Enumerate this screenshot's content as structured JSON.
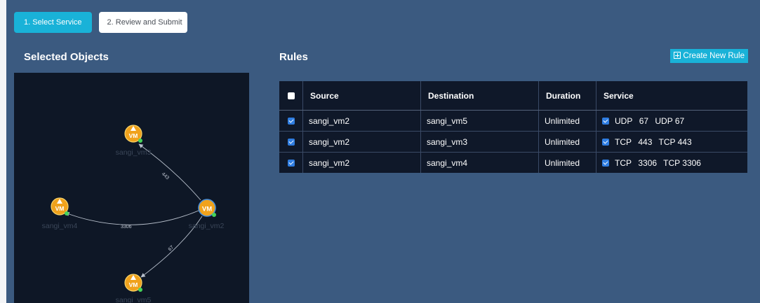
{
  "wizard": {
    "steps": [
      {
        "label": "1. Select Service",
        "active": true
      },
      {
        "label": "2. Review and Submit",
        "active": false
      }
    ]
  },
  "left_panel": {
    "title": "Selected Objects"
  },
  "graph": {
    "nodes": [
      {
        "label": "sangi_vm3",
        "badge": "VM",
        "warning": true
      },
      {
        "label": "sangi_vm4",
        "badge": "VM",
        "warning": true
      },
      {
        "label": "sangi_vm2",
        "badge": "VM",
        "warning": false
      },
      {
        "label": "sangi_vm5",
        "badge": "VM",
        "warning": true
      }
    ],
    "edges": [
      {
        "from": "sangi_vm2",
        "to": "sangi_vm3",
        "label": "443"
      },
      {
        "from": "sangi_vm2",
        "to": "sangi_vm4",
        "label": "3306"
      },
      {
        "from": "sangi_vm2",
        "to": "sangi_vm5",
        "label": "67"
      }
    ]
  },
  "rules": {
    "title": "Rules",
    "create_button": "Create New Rule",
    "columns": [
      "Source",
      "Destination",
      "Duration",
      "Service"
    ],
    "rows": [
      {
        "checked": true,
        "source": "sangi_vm2",
        "destination": "sangi_vm5",
        "duration": "Unlimited",
        "service_checked": true,
        "protocol": "UDP",
        "port": "67",
        "service_name": "UDP 67"
      },
      {
        "checked": true,
        "source": "sangi_vm2",
        "destination": "sangi_vm3",
        "duration": "Unlimited",
        "service_checked": true,
        "protocol": "TCP",
        "port": "443",
        "service_name": "TCP 443"
      },
      {
        "checked": true,
        "source": "sangi_vm2",
        "destination": "sangi_vm4",
        "duration": "Unlimited",
        "service_checked": true,
        "protocol": "TCP",
        "port": "3306",
        "service_name": "TCP 3306"
      }
    ]
  },
  "colors": {
    "background": "#3b5a80",
    "accent": "#19b2d8",
    "graph_bg": "#0e1726",
    "table_bg": "#0f1829",
    "node_orange": "#f0a21c",
    "node_green": "#46d45a",
    "checkbox_blue": "#2f7de1"
  }
}
